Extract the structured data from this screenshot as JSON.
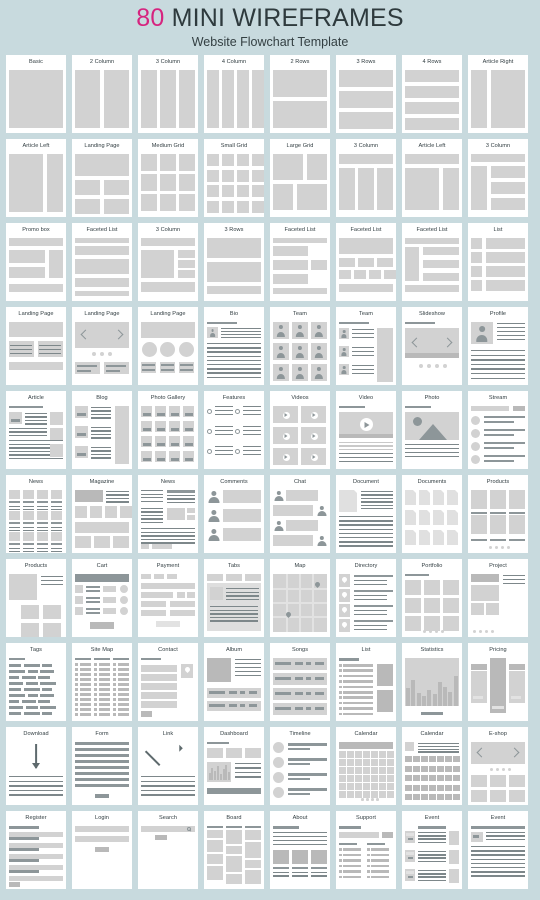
{
  "header": {
    "count": "80",
    "title": " MINI WIREFRAMES",
    "subtitle": "Website Flowchart Template"
  },
  "colors": {
    "background": "#c8dade",
    "card": "#ffffff",
    "accent": "#d6247f",
    "text": "#303c40",
    "block_light": "#d2d2d2",
    "block_dark": "#8d9699"
  },
  "grid": {
    "columns": 8,
    "rows": 10,
    "total": 80
  },
  "cards": [
    {
      "label": "Basic",
      "kind": "basic"
    },
    {
      "label": "2 Column",
      "kind": "col2"
    },
    {
      "label": "3 Column",
      "kind": "col3"
    },
    {
      "label": "4 Column",
      "kind": "col4"
    },
    {
      "label": "2 Rows",
      "kind": "rows2"
    },
    {
      "label": "3 Rows",
      "kind": "rows3"
    },
    {
      "label": "4 Rows",
      "kind": "rows4"
    },
    {
      "label": "Article Right",
      "kind": "articleright"
    },
    {
      "label": "Article Left",
      "kind": "articleleft"
    },
    {
      "label": "Landing Page",
      "kind": "landing1"
    },
    {
      "label": "Medium Grid",
      "kind": "medgrid"
    },
    {
      "label": "Small Grid",
      "kind": "smallgrid"
    },
    {
      "label": "Large Grid",
      "kind": "largegrid"
    },
    {
      "label": "3 Column",
      "kind": "col3b"
    },
    {
      "label": "Article Left",
      "kind": "articleleft2"
    },
    {
      "label": "3 Column",
      "kind": "col3c"
    },
    {
      "label": "Promo box",
      "kind": "promo"
    },
    {
      "label": "Faceted List",
      "kind": "faceted1"
    },
    {
      "label": "3 Column",
      "kind": "col3d"
    },
    {
      "label": "3 Rows",
      "kind": "rows3b"
    },
    {
      "label": "Faceted List",
      "kind": "faceted2"
    },
    {
      "label": "Faceted List",
      "kind": "faceted3"
    },
    {
      "label": "Faceted List",
      "kind": "faceted4"
    },
    {
      "label": "List",
      "kind": "list1"
    },
    {
      "label": "Landing Page",
      "kind": "landing2"
    },
    {
      "label": "Landing Page",
      "kind": "landing3"
    },
    {
      "label": "Landing Page",
      "kind": "landing4"
    },
    {
      "label": "Bio",
      "kind": "bio"
    },
    {
      "label": "Team",
      "kind": "team1"
    },
    {
      "label": "Team",
      "kind": "team2"
    },
    {
      "label": "Slideshow",
      "kind": "slideshow"
    },
    {
      "label": "Profile",
      "kind": "profile"
    },
    {
      "label": "Article",
      "kind": "article"
    },
    {
      "label": "Blog",
      "kind": "blog"
    },
    {
      "label": "Photo Gallery",
      "kind": "photogallery"
    },
    {
      "label": "Features",
      "kind": "features"
    },
    {
      "label": "Videos",
      "kind": "videos"
    },
    {
      "label": "Video",
      "kind": "video"
    },
    {
      "label": "Photo",
      "kind": "photo"
    },
    {
      "label": "Stream",
      "kind": "stream"
    },
    {
      "label": "News",
      "kind": "news1"
    },
    {
      "label": "Magazine",
      "kind": "magazine"
    },
    {
      "label": "News",
      "kind": "news2"
    },
    {
      "label": "Comments",
      "kind": "comments"
    },
    {
      "label": "Chat",
      "kind": "chat"
    },
    {
      "label": "Document",
      "kind": "document"
    },
    {
      "label": "Documents",
      "kind": "documents"
    },
    {
      "label": "Products",
      "kind": "products1"
    },
    {
      "label": "Products",
      "kind": "products2"
    },
    {
      "label": "Cart",
      "kind": "cart"
    },
    {
      "label": "Payment",
      "kind": "payment"
    },
    {
      "label": "Tabs",
      "kind": "tabs"
    },
    {
      "label": "Map",
      "kind": "map"
    },
    {
      "label": "Directory",
      "kind": "directory"
    },
    {
      "label": "Portfolio",
      "kind": "portfolio"
    },
    {
      "label": "Project",
      "kind": "project"
    },
    {
      "label": "Tags",
      "kind": "tags"
    },
    {
      "label": "Site Map",
      "kind": "sitemap"
    },
    {
      "label": "Contact",
      "kind": "contact"
    },
    {
      "label": "Album",
      "kind": "album"
    },
    {
      "label": "Songs",
      "kind": "songs"
    },
    {
      "label": "List",
      "kind": "list2"
    },
    {
      "label": "Statistics",
      "kind": "statistics"
    },
    {
      "label": "Pricing",
      "kind": "pricing"
    },
    {
      "label": "Download",
      "kind": "download"
    },
    {
      "label": "Form",
      "kind": "form"
    },
    {
      "label": "Link",
      "kind": "link"
    },
    {
      "label": "Dashboard",
      "kind": "dashboard"
    },
    {
      "label": "Timeline",
      "kind": "timeline"
    },
    {
      "label": "Calendar",
      "kind": "calendar1"
    },
    {
      "label": "Calendar",
      "kind": "calendar2"
    },
    {
      "label": "E-shop",
      "kind": "eshop"
    },
    {
      "label": "Register",
      "kind": "register"
    },
    {
      "label": "Login",
      "kind": "login"
    },
    {
      "label": "Search",
      "kind": "search"
    },
    {
      "label": "Board",
      "kind": "board"
    },
    {
      "label": "About",
      "kind": "about"
    },
    {
      "label": "Support",
      "kind": "support"
    },
    {
      "label": "Event",
      "kind": "event1"
    },
    {
      "label": "Event",
      "kind": "event2"
    }
  ]
}
